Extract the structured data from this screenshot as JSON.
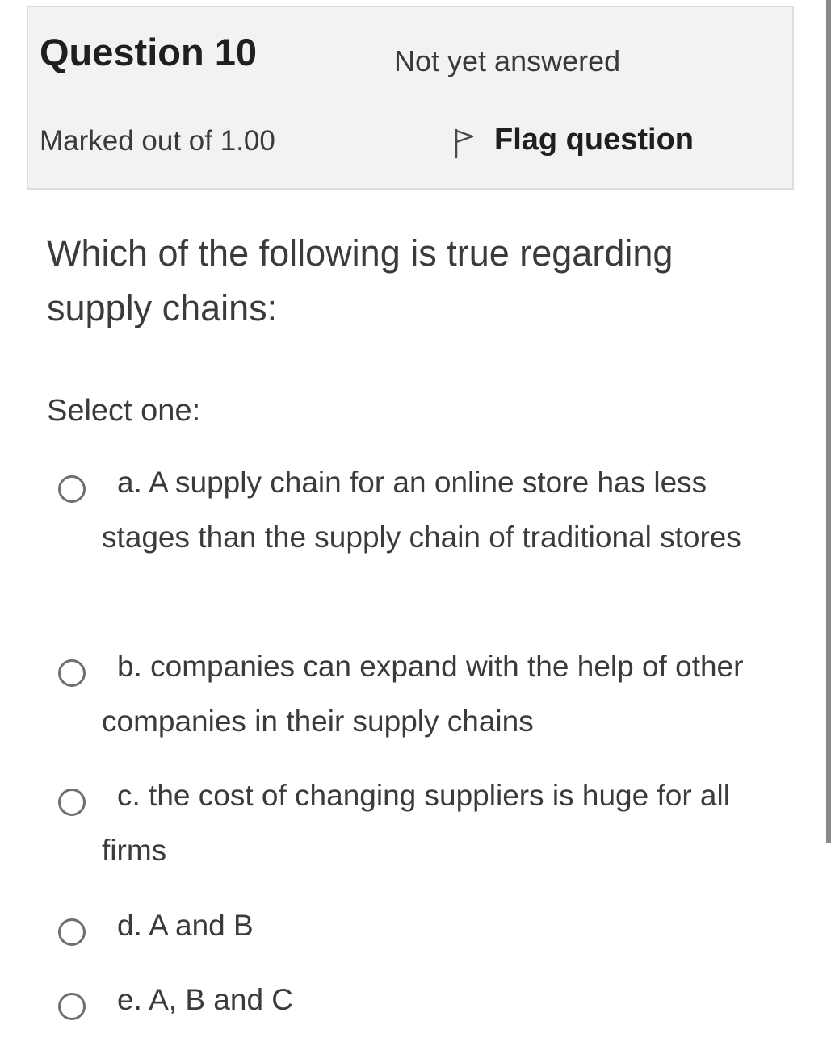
{
  "header": {
    "question_title": "Question 10",
    "state": "Not yet answered",
    "grade": "Marked out of 1.00",
    "flag_label": "Flag question"
  },
  "question": {
    "text": "Which of the following is true regarding supply chains:",
    "prompt": "Select one:"
  },
  "answers": [
    {
      "label": "a. A supply chain for an online store has less stages than the supply chain of traditional stores",
      "selected": false
    },
    {
      "label": "b. companies can expand with the help of other companies in their supply chains",
      "selected": false
    },
    {
      "label": "c. the cost of changing suppliers is huge for all firms",
      "selected": false
    },
    {
      "label": "d. A and B",
      "selected": false
    },
    {
      "label": "e. A, B and C",
      "selected": false
    }
  ],
  "icons": {
    "flag": "flag-outline-icon",
    "radio": "radio-unchecked-icon"
  },
  "colors": {
    "info_box_bg": "#f2f2f2",
    "text": "#3b3b3b",
    "radio_border": "#6f6f6f"
  }
}
